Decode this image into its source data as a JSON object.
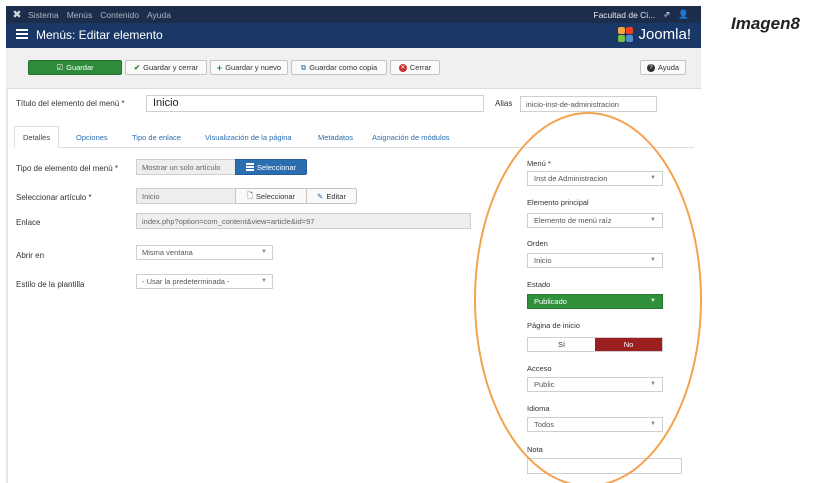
{
  "caption": "Imagen8",
  "topbar": {
    "menus": [
      "Sistema",
      "Menús",
      "Contenido",
      "Ayuda"
    ],
    "site_name": "Facultad de Ci...",
    "external_icon": "external-link-icon",
    "user_icon": "user-icon"
  },
  "header": {
    "title": "Menús: Editar elemento",
    "brand": "Joomla!"
  },
  "toolbar": {
    "save": "Guardar",
    "save_close": "Guardar y cerrar",
    "save_new": "Guardar y nuevo",
    "save_copy": "Guardar como copia",
    "close": "Cerrar",
    "help": "Ayuda"
  },
  "form": {
    "title_label": "Título del elemento del menú *",
    "title_value": "Inicio",
    "alias_label": "Alias",
    "alias_value": "inicio-inst-de-administracion"
  },
  "tabs": [
    "Detalles",
    "Opciones",
    "Tipo de enlace",
    "Visualización de la página",
    "Metadatos",
    "Asignación de módulos"
  ],
  "details": {
    "type_label": "Tipo de elemento del menú *",
    "type_value": "Mostrar un solo artículo",
    "select_button": "Seleccionar",
    "article_label": "Seleccionar artículo *",
    "article_value": "Inicio",
    "article_select": "Seleccionar",
    "article_edit": "Editar",
    "link_label": "Enlace",
    "link_value": "index.php?option=com_content&view=article&id=97",
    "open_label": "Abrir en",
    "open_value": "Misma ventana",
    "style_label": "Estilo de la plantilla",
    "style_value": "- Usar la predeterminada -"
  },
  "sidebar": {
    "menu_label": "Menú *",
    "menu_value": "Inst de Administracion",
    "parent_label": "Elemento principal",
    "parent_value": "Elemento de menú raíz",
    "order_label": "Orden",
    "order_value": "Inicio",
    "status_label": "Estado",
    "status_value": "Publicado",
    "home_label": "Página de inicio",
    "home_yes": "Sí",
    "home_no": "No",
    "access_label": "Acceso",
    "access_value": "Public",
    "language_label": "Idioma",
    "language_value": "Todos",
    "note_label": "Nota",
    "note_value": ""
  },
  "colors": {
    "topbar": "#1c2d4b",
    "header": "#1a3867",
    "save_green": "#2e8b3b",
    "select_blue": "#2a6db0",
    "status_green": "#2f8f3a",
    "toggle_no_red": "#9b1f1f",
    "annotation_oval": "#f4a24c"
  }
}
